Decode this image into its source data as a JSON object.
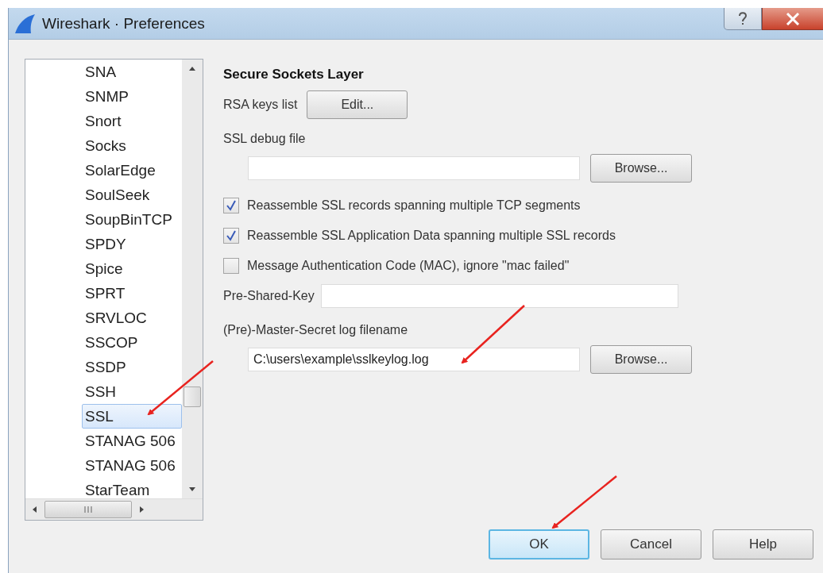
{
  "window": {
    "title": "Wireshark · Preferences"
  },
  "sidebar": {
    "items": [
      {
        "label": "SNA",
        "selected": false
      },
      {
        "label": "SNMP",
        "selected": false
      },
      {
        "label": "Snort",
        "selected": false
      },
      {
        "label": "Socks",
        "selected": false
      },
      {
        "label": "SolarEdge",
        "selected": false
      },
      {
        "label": "SoulSeek",
        "selected": false
      },
      {
        "label": "SoupBinTCP",
        "selected": false
      },
      {
        "label": "SPDY",
        "selected": false
      },
      {
        "label": "Spice",
        "selected": false
      },
      {
        "label": "SPRT",
        "selected": false
      },
      {
        "label": "SRVLOC",
        "selected": false
      },
      {
        "label": "SSCOP",
        "selected": false
      },
      {
        "label": "SSDP",
        "selected": false
      },
      {
        "label": "SSH",
        "selected": false
      },
      {
        "label": "SSL",
        "selected": true
      },
      {
        "label": "STANAG 506",
        "selected": false
      },
      {
        "label": "STANAG 506",
        "selected": false
      },
      {
        "label": "StarTeam",
        "selected": false
      }
    ]
  },
  "panel": {
    "heading": "Secure Sockets Layer",
    "rows": [
      {
        "kind": "label-button",
        "label": "RSA keys list",
        "button": "Edit..."
      },
      {
        "kind": "label",
        "label": "SSL debug file"
      },
      {
        "kind": "file",
        "button": "Browse..."
      },
      {
        "kind": "checkbox",
        "label": "Reassemble SSL records spanning multiple TCP segments",
        "checked": true
      },
      {
        "kind": "checkbox",
        "label": "Reassemble SSL Application Data spanning multiple SSL records",
        "checked": true
      },
      {
        "kind": "checkbox",
        "label": "Message Authentication Code (MAC), ignore \"mac failed\"",
        "checked": false
      },
      {
        "kind": "label-field",
        "label": "Pre-Shared-Key"
      },
      {
        "kind": "label",
        "label": "(Pre)-Master-Secret log filename"
      },
      {
        "kind": "file",
        "value": "C:\\users\\example\\sslkeylog.log",
        "button": "Browse..."
      }
    ]
  },
  "buttons": [
    {
      "label": "OK",
      "selected": true
    },
    {
      "label": "Cancel",
      "selected": false
    },
    {
      "label": "Help",
      "selected": false
    }
  ]
}
